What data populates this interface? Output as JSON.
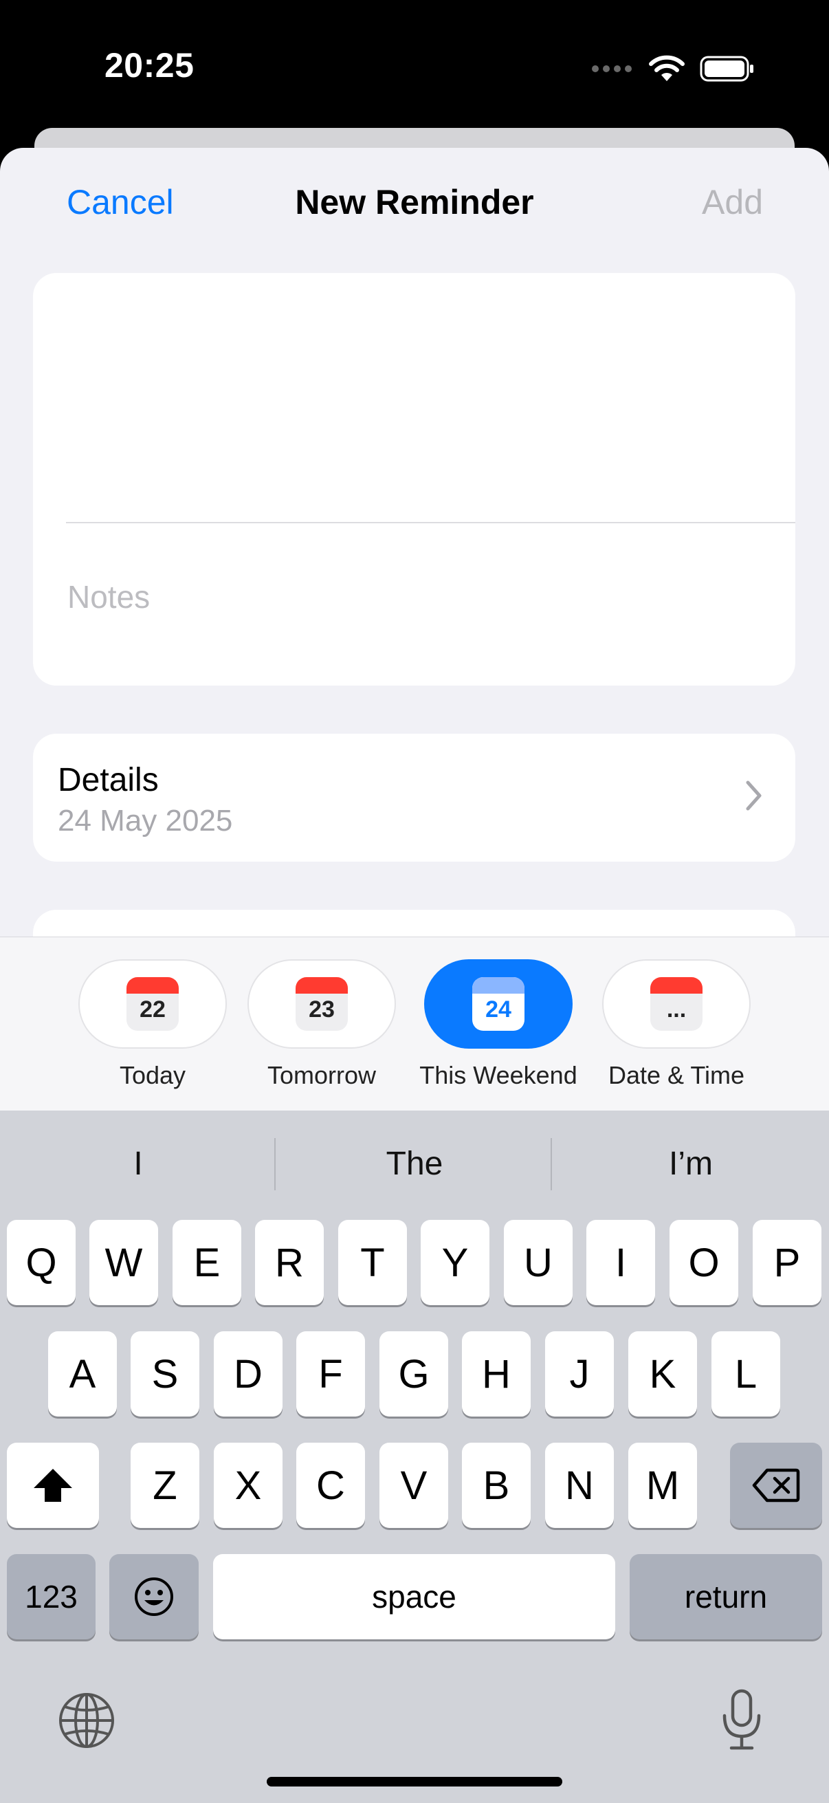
{
  "status": {
    "time": "20:25",
    "icons": [
      "cellular-dots-icon",
      "wifi-icon",
      "battery-icon"
    ]
  },
  "nav": {
    "cancel": "Cancel",
    "title": "New Reminder",
    "add": "Add"
  },
  "reminder": {
    "title_value": "",
    "notes_placeholder": "Notes"
  },
  "details": {
    "label": "Details",
    "value": "24 May 2025"
  },
  "quick_dates": [
    {
      "day": "22",
      "label": "Today",
      "selected": false
    },
    {
      "day": "23",
      "label": "Tomorrow",
      "selected": false
    },
    {
      "day": "24",
      "label": "This Weekend",
      "selected": true
    },
    {
      "day": "...",
      "label": "Date & Time",
      "selected": false
    }
  ],
  "keyboard": {
    "suggestions": [
      "I",
      "The",
      "I’m"
    ],
    "row1": [
      "Q",
      "W",
      "E",
      "R",
      "T",
      "Y",
      "U",
      "I",
      "O",
      "P"
    ],
    "row2": [
      "A",
      "S",
      "D",
      "F",
      "G",
      "H",
      "J",
      "K",
      "L"
    ],
    "row3": [
      "Z",
      "X",
      "C",
      "V",
      "B",
      "N",
      "M"
    ],
    "numbers_key": "123",
    "space_key": "space",
    "return_key": "return"
  },
  "colors": {
    "accent": "#0a7aff",
    "calendar_red": "#ff3b30",
    "sheet_bg": "#f1f1f6",
    "keyboard_bg": "#d1d3d9"
  }
}
